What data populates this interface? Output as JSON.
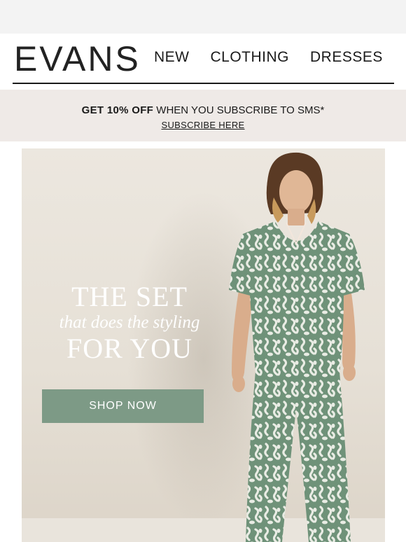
{
  "header": {
    "logo": "EVANS",
    "nav": [
      "NEW",
      "CLOTHING",
      "DRESSES"
    ]
  },
  "promo": {
    "bold": "GET 10% OFF",
    "text": " WHEN YOU SUBSCRIBE TO SMS*",
    "link": "SUBSCRIBE HERE"
  },
  "hero": {
    "title_line1": "THE SET",
    "title_line2": "that does the styling",
    "title_line3": "FOR YOU",
    "button": "SHOP NOW"
  },
  "colors": {
    "accent": "#7d9a86",
    "print_green": "#6f9279",
    "promo_bg": "#efeae7"
  }
}
